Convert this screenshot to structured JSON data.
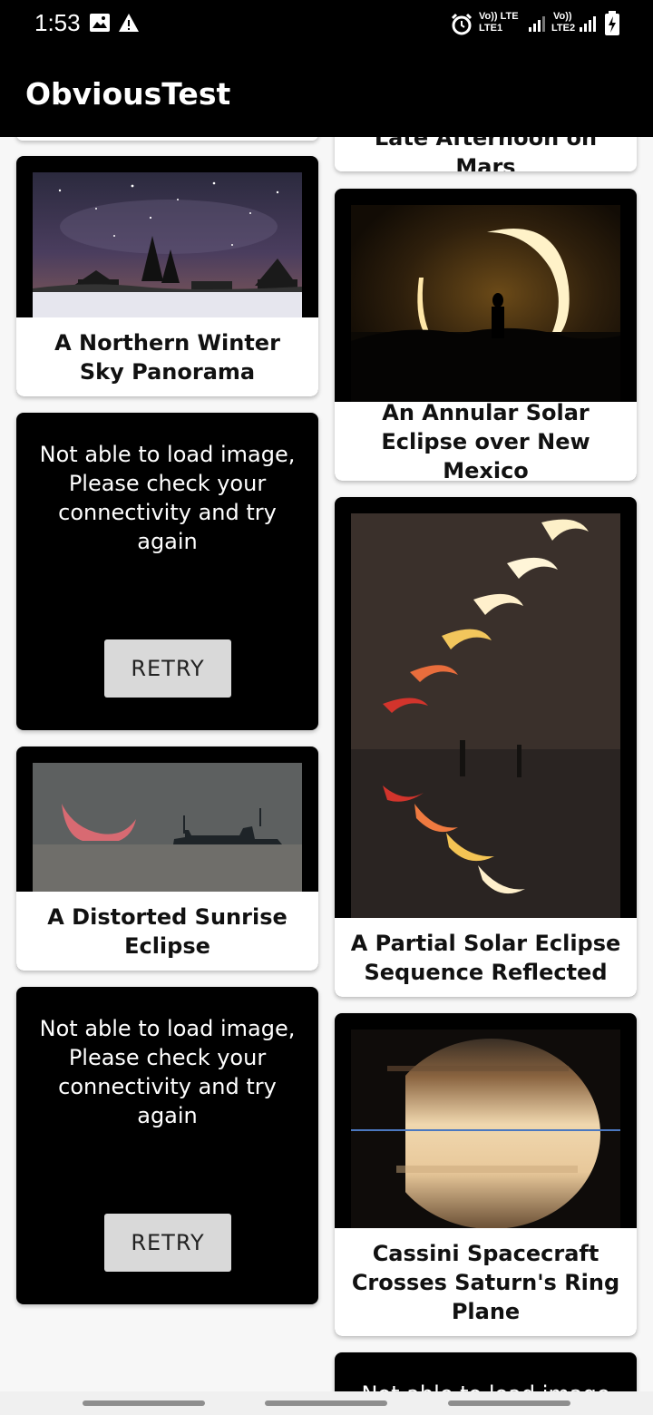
{
  "status_bar": {
    "time": "1:53",
    "network_sim1": "Vo)) LTE",
    "network_sim1_sub": "LTE1",
    "network_sim2": "Vo))",
    "network_sim2_sub": "LTE2"
  },
  "app_bar": {
    "title": "ObviousTest"
  },
  "feed": {
    "left": [
      {
        "type": "image",
        "title": "A Northern Winter Sky Panorama"
      },
      {
        "type": "error",
        "message": "Not able to load image, Please check your connectivity and try again",
        "retry_label": "RETRY"
      },
      {
        "type": "image",
        "title": "A Distorted Sunrise Eclipse"
      },
      {
        "type": "error",
        "message": "Not able to load image, Please check your connectivity and try again",
        "retry_label": "RETRY"
      }
    ],
    "right": [
      {
        "type": "image",
        "title": "Late Afternoon on Mars"
      },
      {
        "type": "image",
        "title": "An Annular Solar Eclipse over New Mexico"
      },
      {
        "type": "image",
        "title": "A Partial Solar Eclipse Sequence Reflected"
      },
      {
        "type": "image",
        "title": "Cassini Spacecraft Crosses Saturn's Ring Plane"
      },
      {
        "type": "error",
        "message": "Not able to load image"
      }
    ]
  },
  "colors": {
    "app_bar": "#000000",
    "background": "#f7f7f7",
    "card_text_bg": "#ffffff",
    "retry_button": "#d9d9d9"
  }
}
